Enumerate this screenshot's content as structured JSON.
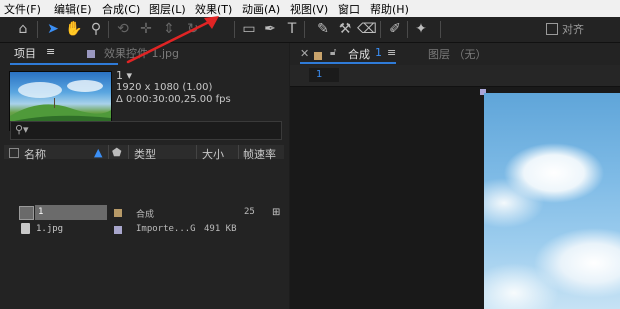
{
  "menu": [
    "文件(F)",
    "编辑(E)",
    "合成(C)",
    "图层(L)",
    "效果(T)",
    "动画(A)",
    "视图(V)",
    "窗口",
    "帮助(H)"
  ],
  "toolbar": {
    "align_label": "对齐"
  },
  "project": {
    "tab_project": "项目",
    "tab_effects": "效果控件 1.jpg",
    "comp_name": "1 ▾",
    "resolution": "1920 x 1080 (1.00)",
    "duration": "Δ 0:00:30:00,25.00 fps",
    "search_icon_glyph": "⚲▾",
    "columns": {
      "name": "名称",
      "type": "类型",
      "size": "大小",
      "fps": "帧速率"
    },
    "rows": [
      {
        "name": "1",
        "type": "合成",
        "size": "",
        "fps": "25",
        "label_color": "#b79a68"
      },
      {
        "name": "1.jpg",
        "type": "Importe...G",
        "size": "491 KB",
        "fps": "",
        "label_color": "#a8a6cc"
      }
    ]
  },
  "composition": {
    "tab_label": "合成",
    "tab_number": "1",
    "tab_menu": "≡",
    "layer_tab": "图层 （无）",
    "name_box": "1"
  },
  "colors": {
    "accent": "#3b8ff5",
    "annotation_arrow": "#e02424",
    "comp_swatch": "#c9a36b"
  }
}
